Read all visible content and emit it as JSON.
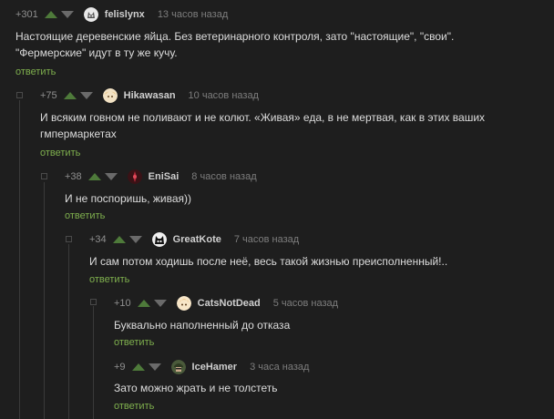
{
  "comments": [
    {
      "rating": "+301",
      "author": "felislynx",
      "time": "13 часов назад",
      "text_lines": [
        "Настоящие деревенские яйца. Без ветеринарного контроля, зато \"настоящие\", \"свои\".",
        "\"Фермерские\" идут в ту же кучу."
      ],
      "reply_label": "ответить",
      "avatar": "cat-avatar"
    },
    {
      "rating": "+75",
      "author": "Hikawasan",
      "time": "10 часов назад",
      "text_lines": [
        "И всяким говном не поливают и не колют. «Живая» еда, в не мертвая, как в этих ваших",
        "гмпермаркетах"
      ],
      "reply_label": "ответить",
      "avatar": "anime-avatar"
    },
    {
      "rating": "+38",
      "author": "EniSai",
      "time": "8 часов назад",
      "text_lines": [
        "И не поспоришь, живая))"
      ],
      "reply_label": "ответить",
      "avatar": "dark-red-avatar"
    },
    {
      "rating": "+34",
      "author": "GreatKote",
      "time": "7 часов назад",
      "text_lines": [
        "И сам потом ходишь после неё, весь такой жизнью преисполненный!.."
      ],
      "reply_label": "ответить",
      "avatar": "black-cat-avatar"
    },
    {
      "rating": "+10",
      "author": "CatsNotDead",
      "time": "5 часов назад",
      "text_lines": [
        "Буквально наполненный до отказа"
      ],
      "reply_label": "ответить",
      "avatar": "anime-avatar"
    },
    {
      "rating": "+9",
      "author": "IceHamer",
      "time": "3 часа назад",
      "text_lines": [
        "Зато можно жрать и не толстеть"
      ],
      "reply_label": "ответить",
      "avatar": "soldier-avatar"
    }
  ],
  "colors": {
    "background": "#1e1e1e",
    "reply_link": "#7fb04e",
    "upvote": "#4e7a3a",
    "thread_line": "#3a3a3a"
  }
}
